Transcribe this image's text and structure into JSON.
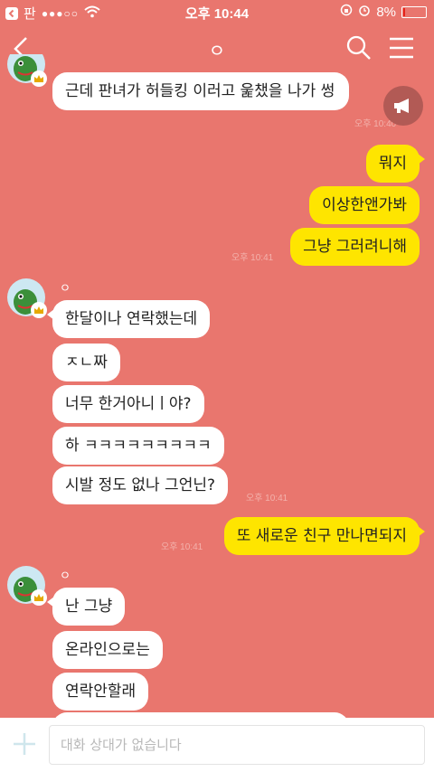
{
  "status": {
    "carrier_label": "판",
    "signal_dots": "●●●○○",
    "time": "오후 10:44",
    "battery_pct": "8%"
  },
  "chat": {
    "title": "ㅇ",
    "sender_name": "ㅇ"
  },
  "messages": {
    "m1": "근데 판녀가 허들킹 이러고 욽챘을 나가 썽",
    "ts1": "오후 10:40",
    "o1": "뭐지",
    "o2": "이상한앤가봐",
    "o3": "그냥 그러려니해",
    "ts2": "오후 10:41",
    "i1": "한달이나 연락했는데",
    "i2": "ㅈㄴ짜",
    "i3": "너무 한거아니ㅣ야?",
    "i4": "하 ㅋㅋㅋㅋㅋㅋㅋㅋㅋ",
    "i5": "시발 정도 없나 그언닌?",
    "ts3": "오후 10:41",
    "o4": "또 새로운 친구 만나면되지",
    "ts4": "오후 10:41",
    "i6": "난 그냥",
    "i7": "온라인으로는",
    "i8": "연락안할래"
  },
  "input": {
    "placeholder": "대화 상대가 없습니다"
  },
  "colors": {
    "background": "#E9766E",
    "outgoing_bubble": "#FEE500",
    "incoming_bubble": "#FFFFFF"
  },
  "icons": [
    "back-arrow-icon",
    "search-icon",
    "menu-icon",
    "megaphone-icon",
    "plus-icon",
    "wifi-icon",
    "alarm-icon",
    "battery-icon"
  ]
}
